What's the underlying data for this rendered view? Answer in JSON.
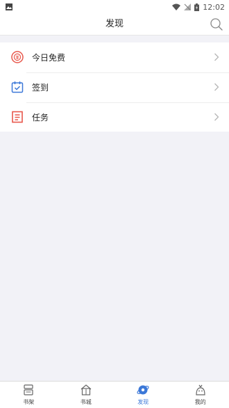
{
  "status_bar": {
    "time": "12:02"
  },
  "header": {
    "title": "发现"
  },
  "menu": {
    "items": [
      {
        "label": "今日免费",
        "icon": "free-today-icon",
        "color": "#e8574b"
      },
      {
        "label": "签到",
        "icon": "checkin-calendar-icon",
        "color": "#3c78d8"
      },
      {
        "label": "任务",
        "icon": "task-list-icon",
        "color": "#e8574b"
      }
    ]
  },
  "tabbar": {
    "active": "发现",
    "accent": "#3c78d8",
    "tabs": [
      {
        "label": "书架",
        "icon": "bookshelf-icon"
      },
      {
        "label": "书城",
        "icon": "bookstore-icon"
      },
      {
        "label": "发现",
        "icon": "discover-icon"
      },
      {
        "label": "我的",
        "icon": "profile-icon"
      }
    ]
  }
}
